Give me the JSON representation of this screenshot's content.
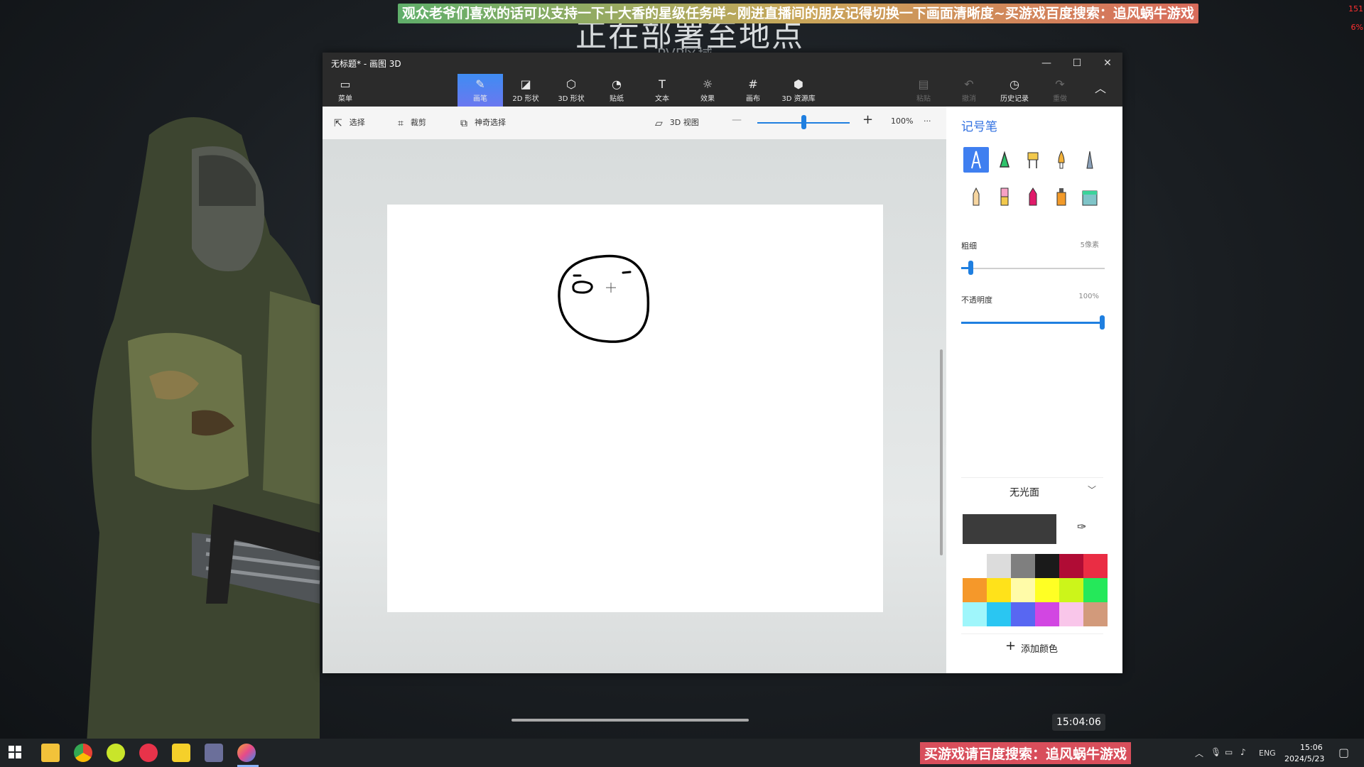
{
  "background": {
    "title": "正在部署至地点",
    "subtitle": "PVP区域"
  },
  "stream": {
    "banner_top": "观众老爷们喜欢的话可以支持一下十大香的星级任务咩~刚进直播间的朋友记得切换一下画面清晰度~买游戏百度搜索：追风蜗牛游戏",
    "banner_bottom": "买游戏请百度搜索：追风蜗牛游戏",
    "stat_1": "151",
    "stat_2": "6%",
    "timestamp": "15:04:06"
  },
  "window": {
    "title": "无标题* - 画图 3D",
    "minimize": "—",
    "maximize": "☐",
    "close": "✕"
  },
  "ribbon": {
    "menu": "菜单",
    "tools": [
      {
        "label": "画笔",
        "icon": "brush-icon"
      },
      {
        "label": "2D 形状",
        "icon": "shapes-2d-icon"
      },
      {
        "label": "3D 形状",
        "icon": "cube-icon"
      },
      {
        "label": "贴纸",
        "icon": "sticker-icon"
      },
      {
        "label": "文本",
        "icon": "text-icon"
      },
      {
        "label": "效果",
        "icon": "sun-icon"
      },
      {
        "label": "画布",
        "icon": "canvas-icon"
      },
      {
        "label": "3D 资源库",
        "icon": "library-icon"
      }
    ],
    "paste": "粘贴",
    "undo": "撤消",
    "history": "历史记录",
    "redo": "重做"
  },
  "subbar": {
    "select": "选择",
    "crop": "裁剪",
    "magic_select": "神奇选择",
    "view_3d": "3D 视图",
    "zoom": "100%",
    "more": "···"
  },
  "panel": {
    "title": "记号笔",
    "thickness_label": "粗细",
    "thickness_value": "5像素",
    "thickness_level": 0.05,
    "opacity_label": "不透明度",
    "opacity_value": "100%",
    "opacity_level": 1.0,
    "finish": "无光面",
    "add_color": "添加颜色",
    "current_color": "#3b3b3b",
    "palette": [
      "#ffffff",
      "#dcdcdc",
      "#7f7f7f",
      "#1a1a1a",
      "#b00c35",
      "#ea2d44",
      "#f5982a",
      "#ffe21a",
      "#fffba8",
      "#ffff24",
      "#ccf51a",
      "#25e85a",
      "#9ff6fb",
      "#2ac6f2",
      "#5867f2",
      "#d246e2",
      "#f9c6ea",
      "#d29a7b"
    ]
  },
  "taskbar": {
    "lang": "ENG",
    "time": "15:06",
    "date": "2024/5/23"
  }
}
